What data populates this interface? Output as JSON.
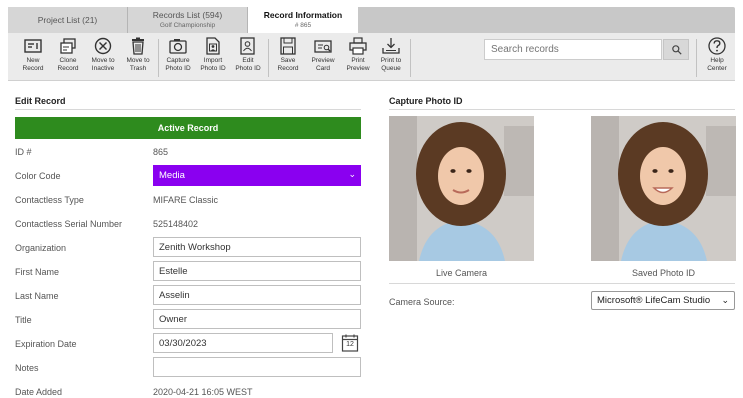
{
  "tabs": [
    {
      "title": "Project List (21)",
      "subtitle": ""
    },
    {
      "title": "Records List (594)",
      "subtitle": "Golf Championship"
    },
    {
      "title": "Record Information",
      "subtitle": "# 865"
    }
  ],
  "toolbar": {
    "buttons": [
      {
        "line1": "New",
        "line2": "Record",
        "icon": "new-record-icon"
      },
      {
        "line1": "Clone",
        "line2": "Record",
        "icon": "clone-record-icon"
      },
      {
        "line1": "Move to",
        "line2": "Inactive",
        "icon": "move-inactive-icon"
      },
      {
        "line1": "Move to",
        "line2": "Trash",
        "icon": "trash-icon"
      },
      {
        "line1": "Capture",
        "line2": "Photo ID",
        "icon": "camera-icon"
      },
      {
        "line1": "Import",
        "line2": "Photo ID",
        "icon": "import-photo-icon"
      },
      {
        "line1": "Edit",
        "line2": "Photo ID",
        "icon": "edit-photo-icon"
      },
      {
        "line1": "Save",
        "line2": "Record",
        "icon": "save-icon"
      },
      {
        "line1": "Preview",
        "line2": "Card",
        "icon": "preview-card-icon"
      },
      {
        "line1": "Print",
        "line2": "Preview",
        "icon": "print-icon"
      },
      {
        "line1": "Print to",
        "line2": "Queue",
        "icon": "print-queue-icon"
      }
    ],
    "search_placeholder": "Search records",
    "help": {
      "line1": "Help",
      "line2": "Center"
    }
  },
  "edit_record": {
    "title": "Edit Record",
    "status": "Active Record",
    "id_label": "ID #",
    "id_value": "865",
    "color_code_label": "Color Code",
    "color_code_value": "Media",
    "contactless_type_label": "Contactless Type",
    "contactless_type_value": "MIFARE Classic",
    "serial_label": "Contactless Serial Number",
    "serial_value": "525148402",
    "organization_label": "Organization",
    "organization_value": "Zenith Workshop",
    "first_name_label": "First Name",
    "first_name_value": "Estelle",
    "last_name_label": "Last Name",
    "last_name_value": "Asselin",
    "title_label": "Title",
    "title_value": "Owner",
    "expiration_label": "Expiration Date",
    "expiration_value": "03/30/2023",
    "calendar_day": "12",
    "notes_label": "Notes",
    "notes_value": "",
    "date_added_label": "Date Added",
    "date_added_value": "2020-04-21 16:05 WEST"
  },
  "capture": {
    "title": "Capture Photo ID",
    "live_caption": "Live Camera",
    "saved_caption": "Saved Photo ID",
    "camera_source_label": "Camera Source:",
    "camera_source_value": "Microsoft® LifeCam Studio"
  },
  "colors": {
    "active_green": "#2e8b1e",
    "color_code_purple": "#8a00f0"
  }
}
